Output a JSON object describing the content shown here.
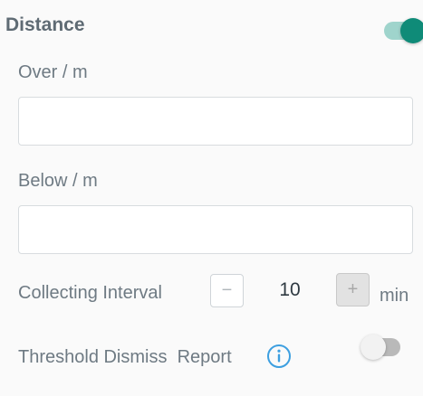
{
  "section": {
    "title": "Distance",
    "toggle_on": true
  },
  "over": {
    "label": "Over / m",
    "value": "",
    "placeholder": ""
  },
  "below": {
    "label": "Below / m",
    "value": "",
    "placeholder": ""
  },
  "interval": {
    "label": "Collecting Interval",
    "minus_symbol": "−",
    "value": "10",
    "plus_symbol": "+",
    "unit": "min"
  },
  "threshold": {
    "label": "Threshold Dismiss  Report",
    "info_icon": "info-icon",
    "toggle_on": false
  },
  "colors": {
    "accent": "#0f8b78",
    "accent_track": "#9fd4cc",
    "info_blue": "#3d9fe0"
  }
}
